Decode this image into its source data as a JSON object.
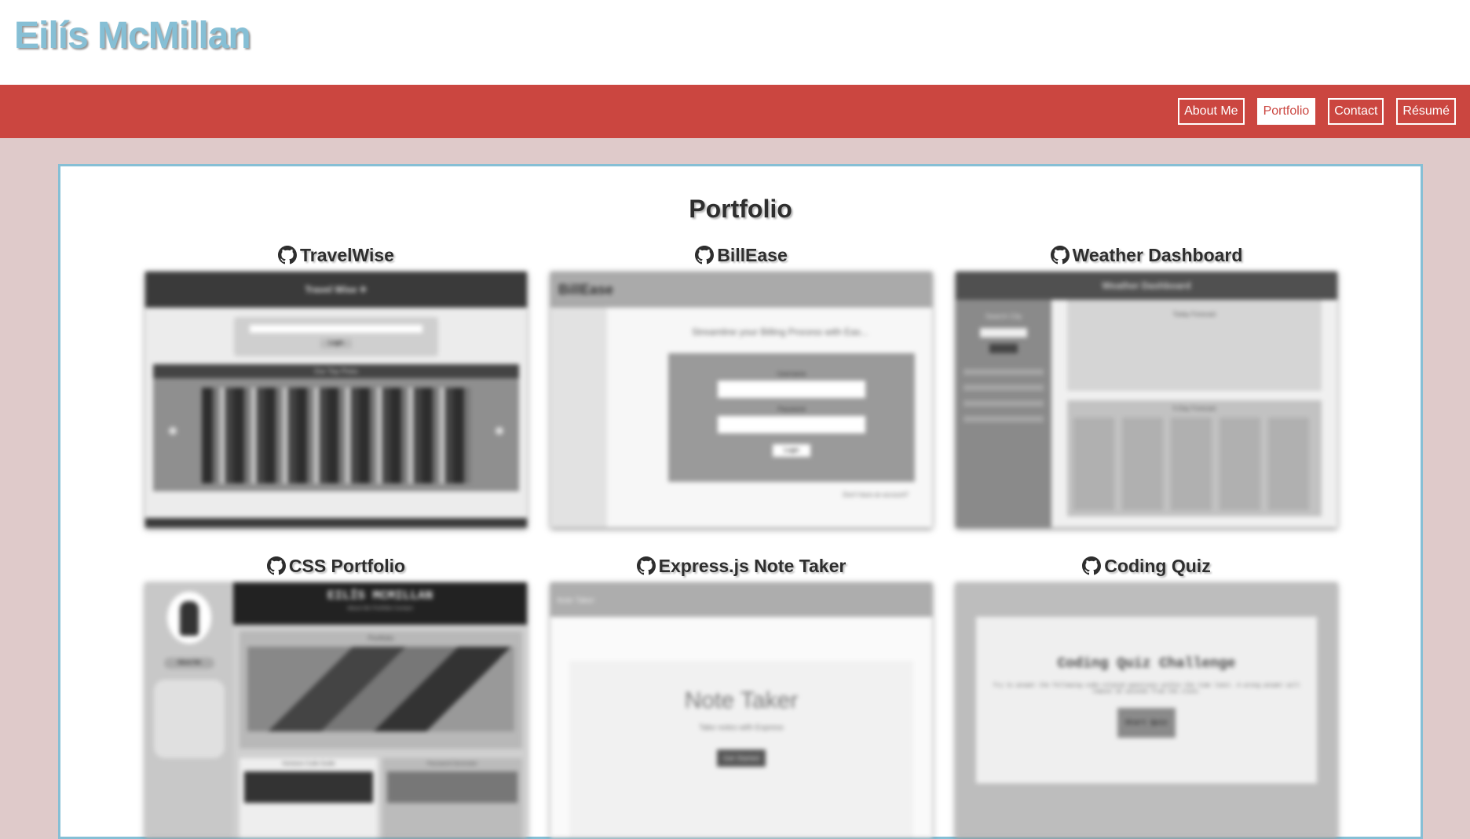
{
  "header": {
    "title": "Eilís McMillan"
  },
  "nav": {
    "items": [
      {
        "label": "About Me"
      },
      {
        "label": "Portfolio"
      },
      {
        "label": "Contact"
      },
      {
        "label": "Résumé"
      }
    ],
    "active_index": 1
  },
  "portfolio": {
    "title": "Portfolio",
    "projects": [
      {
        "name": "TravelWise",
        "preview": {
          "header": "Travel Wise ✈",
          "button": "Login",
          "banner": "Our Top Picks"
        }
      },
      {
        "name": "BillEase",
        "preview": {
          "logo": "BillEase",
          "tagline": "Streamline your Billing Process with Eas...",
          "field1": "Username",
          "field2": "Password",
          "button": "Login",
          "footer": "Don't have an account?",
          "footer_button": "Sign Up"
        }
      },
      {
        "name": "Weather Dashboard",
        "preview": {
          "header": "Weather Dashboard",
          "sidebar_label": "Search City",
          "current_label": "Today Forecast",
          "forecast_label": "5-Day Forecast"
        }
      },
      {
        "name": "CSS Portfolio",
        "preview": {
          "header": "EILÍS MCMILLAN",
          "nav": "About Me  Portfolio  Contact",
          "section": "Portfolio",
          "sidebar_button": "About Me",
          "card1": "Horiseon Code Guide",
          "card2": "Password Generator"
        }
      },
      {
        "name": "Express.js Note Taker",
        "preview": {
          "header": "Note Taker",
          "title": "Note Taker",
          "subtitle": "Take notes with Express",
          "button": "Get Started"
        }
      },
      {
        "name": "Coding Quiz",
        "preview": {
          "title": "Coding Quiz Challenge",
          "text": "Try to answer the following code-related questions within the time limit. A wrong answer will remove 10 seconds from the clock.",
          "button": "Start Quiz"
        }
      }
    ]
  },
  "colors": {
    "accent": "#86bfd5",
    "nav_bg": "#cb4640",
    "page_bg": "#dfcaca"
  }
}
